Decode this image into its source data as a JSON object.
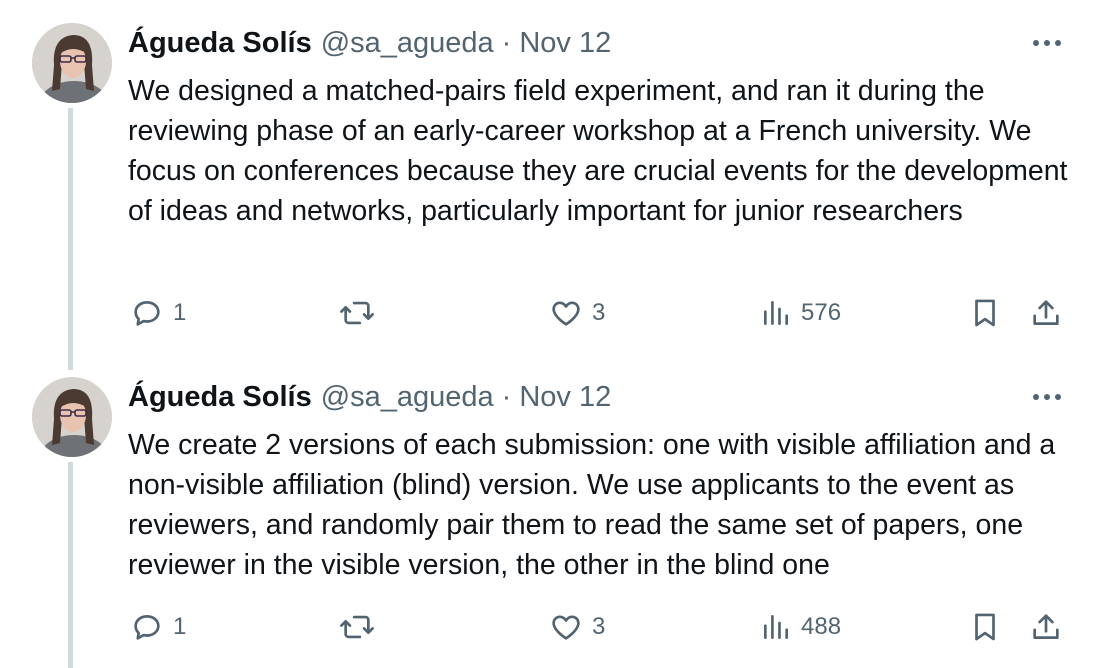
{
  "tweets": [
    {
      "author_name": "Águeda Solís",
      "handle": "@sa_agueda",
      "separator": "·",
      "date": "Nov 12",
      "text": "We designed a matched-pairs field experiment, and ran it during the reviewing phase of an early-career workshop at a French university. We focus on conferences because they are crucial events for the development of ideas and networks, particularly important for junior researchers",
      "replies": "1",
      "reposts": "",
      "likes": "3",
      "views": "576"
    },
    {
      "author_name": "Águeda Solís",
      "handle": "@sa_agueda",
      "separator": "·",
      "date": "Nov 12",
      "text": "We create 2 versions of each submission: one with visible affiliation and a non-visible affiliation (blind) version. We use applicants to the event as reviewers, and randomly pair them to read the same set of papers, one reviewer in the visible version, the other in the blind one",
      "replies": "1",
      "reposts": "",
      "likes": "3",
      "views": "488"
    }
  ],
  "icons": {
    "reply": "reply-icon",
    "repost": "repost-icon",
    "like": "like-icon",
    "views": "views-icon",
    "bookmark": "bookmark-icon",
    "share": "share-icon",
    "more": "more-icon"
  },
  "colors": {
    "text_primary": "#0f1419",
    "text_secondary": "#536471",
    "thread_line": "#cfd9de"
  }
}
